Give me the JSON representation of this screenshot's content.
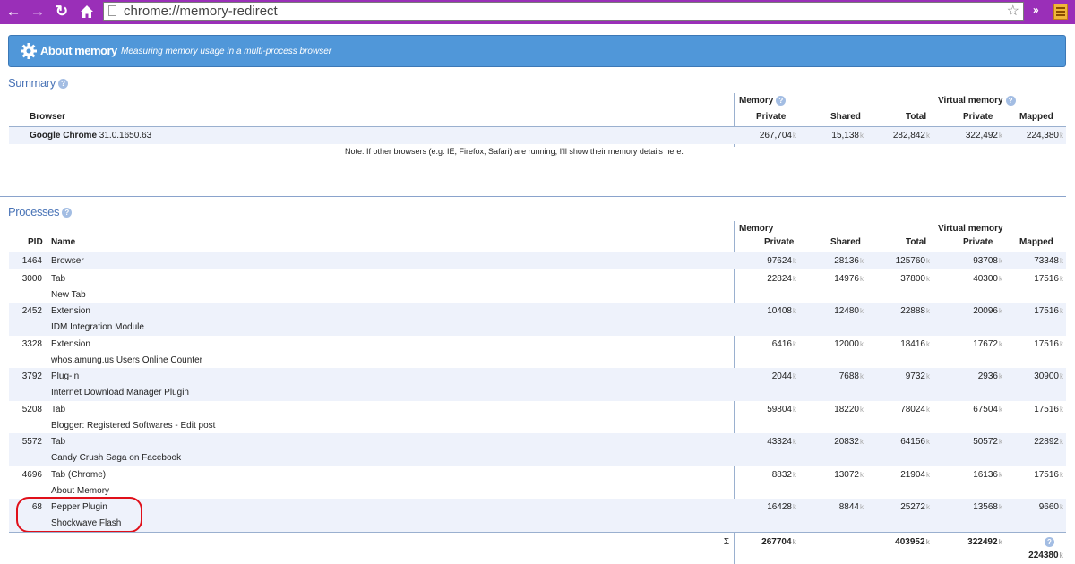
{
  "browser": {
    "url": "chrome://memory-redirect",
    "ext_label": "»"
  },
  "header": {
    "title": "About memory",
    "subtitle": "Measuring memory usage in a multi-process browser"
  },
  "summary": {
    "section_title": "Summary",
    "help": "?",
    "col_browser": "Browser",
    "group_memory": "Memory",
    "group_virtual": "Virtual memory",
    "cols": [
      "Private",
      "Shared",
      "Total",
      "Private",
      "Mapped"
    ],
    "row": {
      "name": "Google Chrome",
      "version": "31.0.1650.63",
      "values": [
        "267,704",
        "15,138",
        "282,842",
        "322,492",
        "224,380"
      ]
    },
    "unit": "k",
    "note": "Note: If other browsers (e.g. IE, Firefox, Safari) are running, I'll show their memory details here."
  },
  "processes": {
    "section_title": "Processes",
    "col_pid": "PID",
    "col_name": "Name",
    "group_memory": "Memory",
    "group_virtual": "Virtual memory",
    "cols": [
      "Private",
      "Shared",
      "Total",
      "Private",
      "Mapped"
    ],
    "unit": "k",
    "rows": [
      {
        "pid": "1464",
        "type": "Browser",
        "title": "",
        "values": [
          "97624",
          "28136",
          "125760",
          "93708",
          "73348"
        ]
      },
      {
        "pid": "3000",
        "type": "Tab",
        "title": "New Tab",
        "values": [
          "22824",
          "14976",
          "37800",
          "40300",
          "17516"
        ]
      },
      {
        "pid": "2452",
        "type": "Extension",
        "title": "IDM Integration Module",
        "values": [
          "10408",
          "12480",
          "22888",
          "20096",
          "17516"
        ]
      },
      {
        "pid": "3328",
        "type": "Extension",
        "title": "whos.amung.us Users Online Counter",
        "values": [
          "6416",
          "12000",
          "18416",
          "17672",
          "17516"
        ]
      },
      {
        "pid": "3792",
        "type": "Plug-in",
        "title": "Internet Download Manager Plugin",
        "values": [
          "2044",
          "7688",
          "9732",
          "2936",
          "30900"
        ]
      },
      {
        "pid": "5208",
        "type": "Tab",
        "title": "Blogger: Registered Softwares - Edit post",
        "values": [
          "59804",
          "18220",
          "78024",
          "67504",
          "17516"
        ]
      },
      {
        "pid": "5572",
        "type": "Tab",
        "title": "Candy Crush Saga on Facebook",
        "values": [
          "43324",
          "20832",
          "64156",
          "50572",
          "22892"
        ]
      },
      {
        "pid": "4696",
        "type": "Tab (Chrome)",
        "title": "About Memory",
        "values": [
          "8832",
          "13072",
          "21904",
          "16136",
          "17516"
        ]
      },
      {
        "pid": "68",
        "type": "Pepper Plugin",
        "title": "Shockwave Flash",
        "values": [
          "16428",
          "8844",
          "25272",
          "13568",
          "9660"
        ]
      }
    ],
    "totals": {
      "sigma": "Σ",
      "private": "267704",
      "total": "403952",
      "virtual_private": "322492",
      "mapped": "224380"
    }
  }
}
